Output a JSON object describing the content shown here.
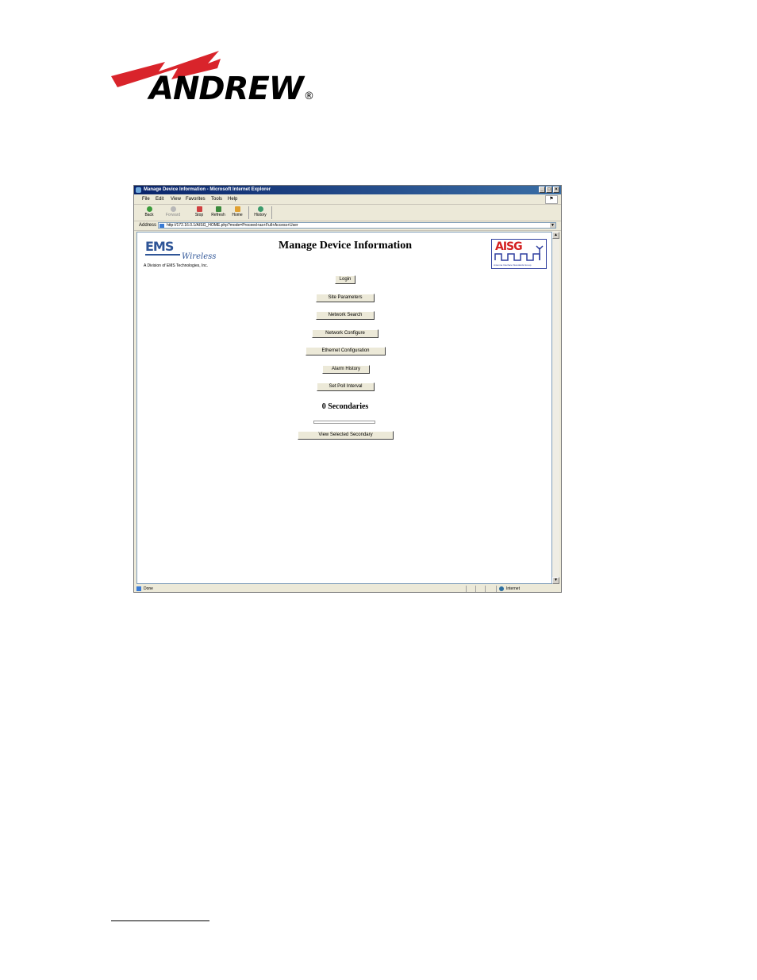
{
  "brand": {
    "name": "ANDREW",
    "reg_mark": "®"
  },
  "browser": {
    "title": "Manage Device Information - Microsoft Internet Explorer",
    "menu": [
      "File",
      "Edit",
      "View",
      "Favorites",
      "Tools",
      "Help"
    ],
    "toolbar": {
      "back": "Back",
      "forward": "Forward",
      "stop": "Stop",
      "refresh": "Refresh",
      "home": "Home",
      "history": "History"
    },
    "address_label": "Address",
    "url": "http://172.16.0.1/AISG_HOME.php?mode=Proceed+as+Full+Access+User",
    "status": "Done",
    "zone": "Internet"
  },
  "page": {
    "ems": {
      "logo": "EMS",
      "wireless": "Wireless",
      "division": "A Division of EMS Technologies, Inc."
    },
    "title": "Manage Device Information",
    "aisg": {
      "logo": "AISG",
      "sub": "Antenna Interface Standards Group"
    },
    "buttons": {
      "login": "Login",
      "site_parameters": "Site Parameters",
      "network_search": "Network Search",
      "network_configure": "Network Configure",
      "ethernet_configuration": "Ethernet Configuration",
      "alarm_history": "Alarm History",
      "set_poll_interval": "Set Poll Interval",
      "view_selected_secondary": "View Selected Secondary"
    },
    "secondaries": "0 Secondaries"
  },
  "colors": {
    "andrew_red": "#d9242b",
    "ems_blue": "#2f5597",
    "aisg_red": "#d32020",
    "titlebar": "#0a246a"
  }
}
